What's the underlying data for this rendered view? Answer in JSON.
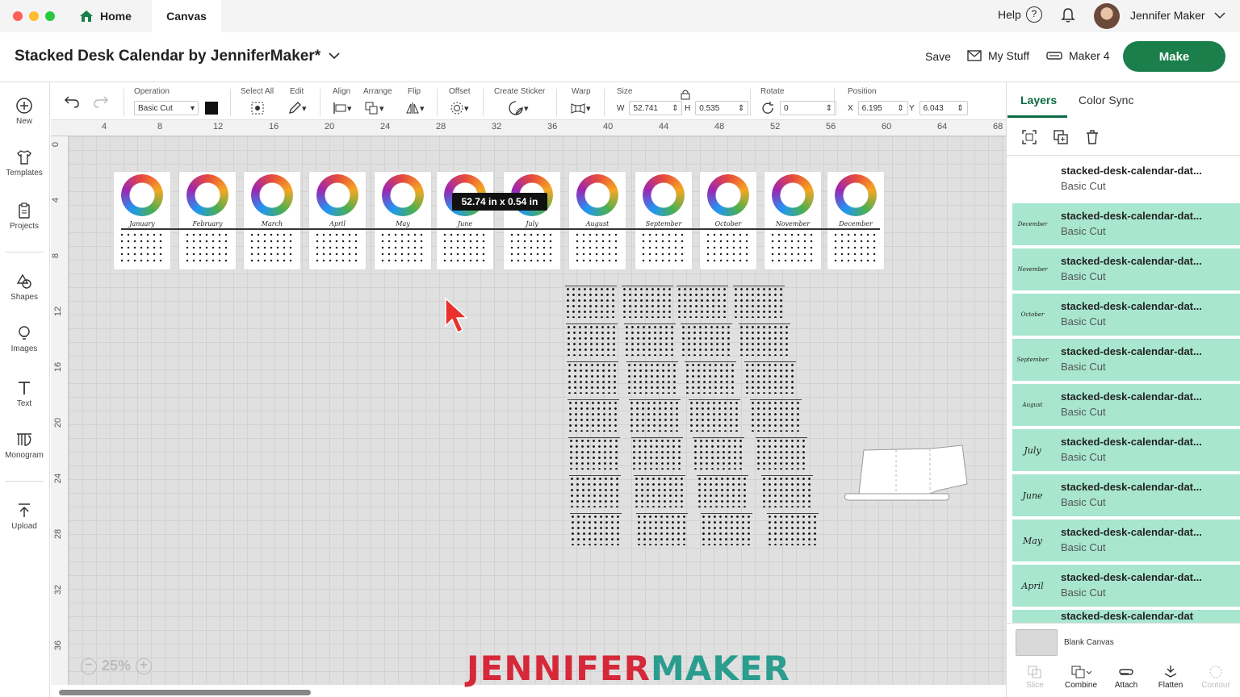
{
  "topbar": {
    "home_label": "Home",
    "canvas_label": "Canvas",
    "help_label": "Help",
    "user_name": "Jennifer Maker"
  },
  "titlebar": {
    "project_title": "Stacked Desk Calendar by JenniferMaker*",
    "save_label": "Save",
    "mystuff_label": "My Stuff",
    "machine_label": "Maker 4",
    "make_label": "Make"
  },
  "leftrail": [
    {
      "label": "New",
      "icon": "plus-circle-icon"
    },
    {
      "label": "Templates",
      "icon": "shirt-icon"
    },
    {
      "label": "Projects",
      "icon": "clipboard-icon"
    },
    {
      "label": "Shapes",
      "icon": "shapes-icon"
    },
    {
      "label": "Images",
      "icon": "lightbulb-icon"
    },
    {
      "label": "Text",
      "icon": "text-t-icon"
    },
    {
      "label": "Monogram",
      "icon": "monogram-icon"
    },
    {
      "label": "Upload",
      "icon": "upload-icon"
    }
  ],
  "toolbar": {
    "operation_label": "Operation",
    "operation_value": "Basic Cut",
    "select_all_label": "Select All",
    "edit_label": "Edit",
    "align_label": "Align",
    "arrange_label": "Arrange",
    "flip_label": "Flip",
    "offset_label": "Offset",
    "create_sticker_label": "Create Sticker",
    "warp_label": "Warp",
    "size_label": "Size",
    "w_label": "W",
    "w_value": "52.741",
    "h_label": "H",
    "h_value": "0.535",
    "rotate_label": "Rotate",
    "rotate_value": "0",
    "position_label": "Position",
    "x_label": "X",
    "x_value": "6.195",
    "y_label": "Y",
    "y_value": "6.043"
  },
  "ruler": {
    "top": [
      "4",
      "8",
      "12",
      "16",
      "20",
      "24",
      "28",
      "32",
      "36",
      "40",
      "44",
      "48",
      "52",
      "56",
      "60",
      "64",
      "68"
    ],
    "left": [
      "0",
      "4",
      "8",
      "12",
      "16",
      "20",
      "24",
      "28",
      "32",
      "36"
    ]
  },
  "canvas": {
    "months": [
      "January",
      "February",
      "March",
      "April",
      "May",
      "June",
      "July",
      "August",
      "September",
      "October",
      "November",
      "December"
    ],
    "size_tooltip": "52.74  in x 0.54  in",
    "zoom": "25%",
    "brand_part1": "JENNIFER",
    "brand_part2": "MAKER",
    "brand_color1": "#d62839",
    "brand_color2": "#2a9d8f"
  },
  "panel": {
    "tab_layers": "Layers",
    "tab_colorsync": "Color Sync",
    "layers": [
      {
        "name": "stacked-desk-calendar-dat...",
        "op": "Basic Cut",
        "thumb": "",
        "selected": false
      },
      {
        "name": "stacked-desk-calendar-dat...",
        "op": "Basic Cut",
        "thumb": "December",
        "selected": true
      },
      {
        "name": "stacked-desk-calendar-dat...",
        "op": "Basic Cut",
        "thumb": "November",
        "selected": true
      },
      {
        "name": "stacked-desk-calendar-dat...",
        "op": "Basic Cut",
        "thumb": "October",
        "selected": true
      },
      {
        "name": "stacked-desk-calendar-dat...",
        "op": "Basic Cut",
        "thumb": "September",
        "selected": true
      },
      {
        "name": "stacked-desk-calendar-dat...",
        "op": "Basic Cut",
        "thumb": "August",
        "selected": true
      },
      {
        "name": "stacked-desk-calendar-dat...",
        "op": "Basic Cut",
        "thumb": "July",
        "selected": true
      },
      {
        "name": "stacked-desk-calendar-dat...",
        "op": "Basic Cut",
        "thumb": "June",
        "selected": true
      },
      {
        "name": "stacked-desk-calendar-dat...",
        "op": "Basic Cut",
        "thumb": "May",
        "selected": true
      },
      {
        "name": "stacked-desk-calendar-dat...",
        "op": "Basic Cut",
        "thumb": "April",
        "selected": true
      },
      {
        "name": "stacked-desk-calendar-dat",
        "op": "",
        "thumb": "",
        "selected": true
      }
    ],
    "blank_canvas_label": "Blank Canvas",
    "actions": [
      {
        "label": "Slice",
        "disabled": true
      },
      {
        "label": "Combine",
        "disabled": false
      },
      {
        "label": "Attach",
        "disabled": false
      },
      {
        "label": "Flatten",
        "disabled": false
      },
      {
        "label": "Contour",
        "disabled": true
      }
    ]
  }
}
